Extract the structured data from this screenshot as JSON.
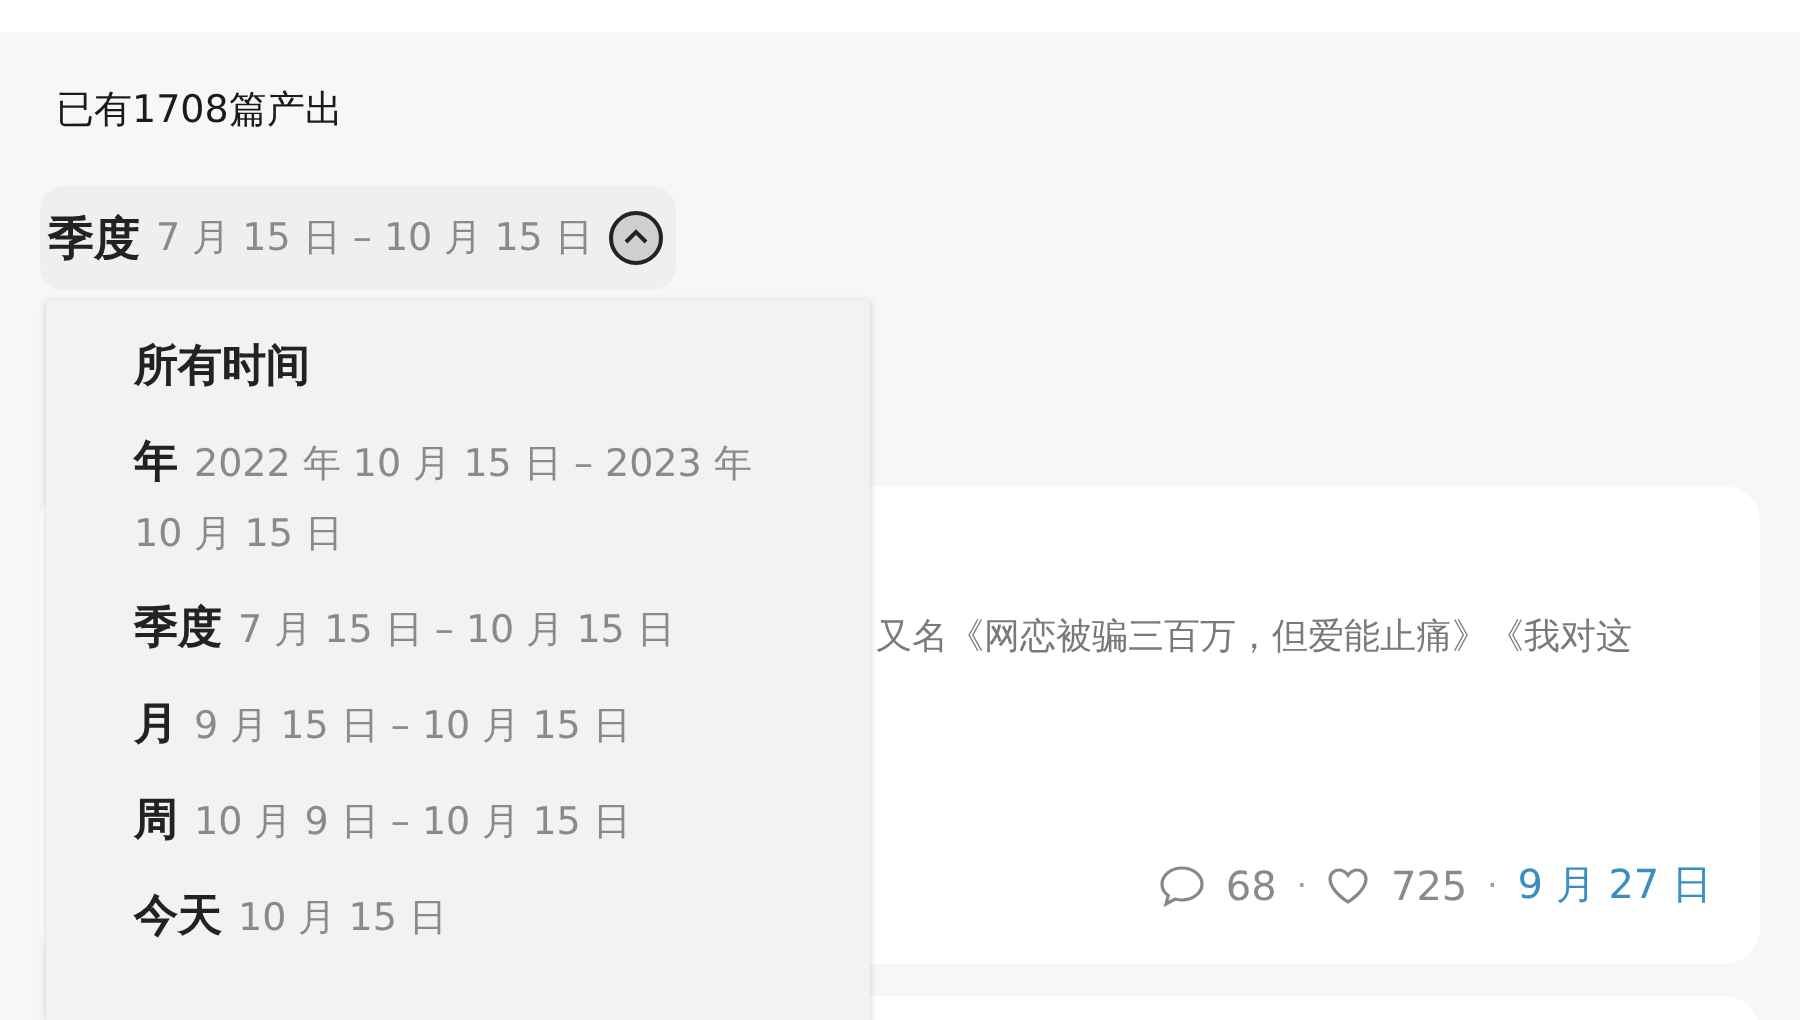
{
  "header": {
    "title": "已有1708篇产出"
  },
  "filter": {
    "label": "季度",
    "range": "7 月 15 日 – 10 月 15 日",
    "expanded": true
  },
  "dropdown": {
    "items": [
      {
        "label": "所有时间"
      },
      {
        "label": "年",
        "range": "2022 年 10 月 15 日 – 2023 年 10 月 15 日"
      },
      {
        "label": "季度",
        "range": "7 月 15 日 – 10 月 15 日"
      },
      {
        "label": "月",
        "range": "9 月 15 日 – 10 月 15 日"
      },
      {
        "label": "周",
        "range": "10 月 9 日 – 10 月 15 日"
      },
      {
        "label": "今天",
        "range": "10 月 15 日"
      }
    ]
  },
  "post": {
    "excerpt": "又名《网恋被骗三百万，但爱能止痛》《我对这",
    "comments": "68",
    "likes": "725",
    "date": "9 月 27 日",
    "separators": [
      "·",
      "·"
    ]
  }
}
